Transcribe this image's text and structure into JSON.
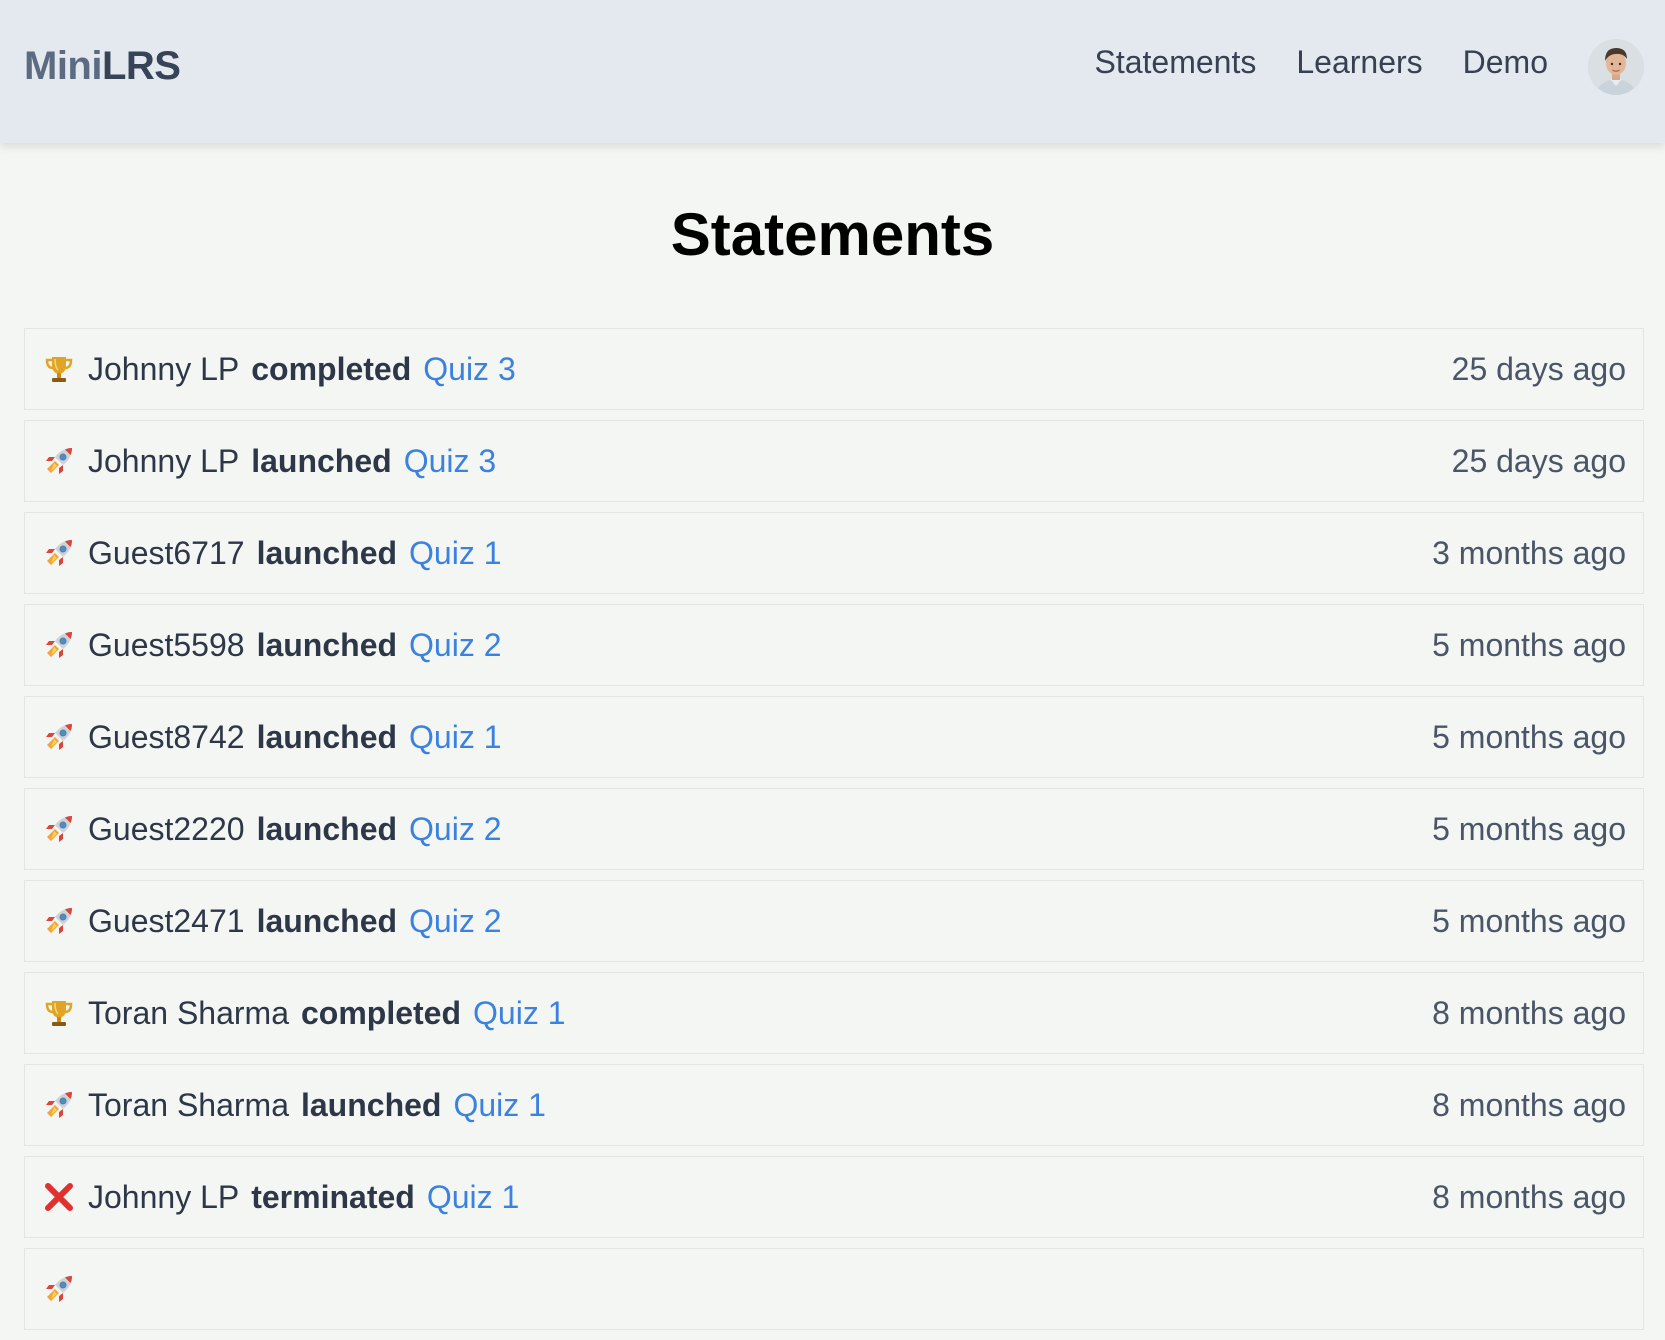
{
  "header": {
    "brand_mini": "Mini",
    "brand_lrs": "LRS",
    "nav": [
      {
        "label": "Statements"
      },
      {
        "label": "Learners"
      },
      {
        "label": "Demo"
      }
    ]
  },
  "page": {
    "title": "Statements"
  },
  "statements": [
    {
      "icon": "trophy-icon",
      "actor": "Johnny LP",
      "verb": "completed",
      "object": "Quiz 3",
      "time": "25 days ago"
    },
    {
      "icon": "rocket-icon",
      "actor": "Johnny LP",
      "verb": "launched",
      "object": "Quiz 3",
      "time": "25 days ago"
    },
    {
      "icon": "rocket-icon",
      "actor": "Guest6717",
      "verb": "launched",
      "object": "Quiz 1",
      "time": "3 months ago"
    },
    {
      "icon": "rocket-icon",
      "actor": "Guest5598",
      "verb": "launched",
      "object": "Quiz 2",
      "time": "5 months ago"
    },
    {
      "icon": "rocket-icon",
      "actor": "Guest8742",
      "verb": "launched",
      "object": "Quiz 1",
      "time": "5 months ago"
    },
    {
      "icon": "rocket-icon",
      "actor": "Guest2220",
      "verb": "launched",
      "object": "Quiz 2",
      "time": "5 months ago"
    },
    {
      "icon": "rocket-icon",
      "actor": "Guest2471",
      "verb": "launched",
      "object": "Quiz 2",
      "time": "5 months ago"
    },
    {
      "icon": "trophy-icon",
      "actor": "Toran Sharma",
      "verb": "completed",
      "object": "Quiz 1",
      "time": "8 months ago"
    },
    {
      "icon": "rocket-icon",
      "actor": "Toran Sharma",
      "verb": "launched",
      "object": "Quiz 1",
      "time": "8 months ago"
    },
    {
      "icon": "cross-mark-icon",
      "actor": "Johnny LP",
      "verb": "terminated",
      "object": "Quiz 1",
      "time": "8 months ago"
    },
    {
      "icon": "rocket-icon",
      "actor": "",
      "verb": "",
      "object": "",
      "time": ""
    }
  ],
  "colors": {
    "header_bg": "#e4e9f0",
    "page_bg": "#f4f6f4",
    "link": "#3b82e0",
    "text": "#2d3748"
  }
}
